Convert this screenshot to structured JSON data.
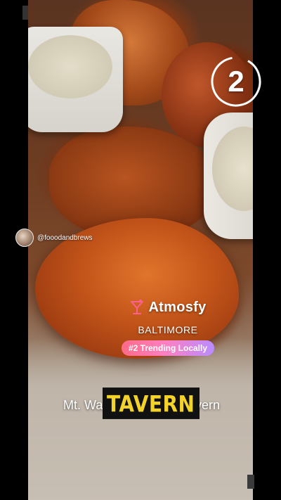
{
  "overlay": {
    "rank_number": "2",
    "creator_handle": "@fooodandbrews",
    "brand_name": "Atmosfy",
    "city": "BALTIMORE",
    "trend_badge": "#2 Trending Locally",
    "caption_left": "Mt. Wa",
    "caption_right": "avern",
    "highlight_word": "TAVERN"
  },
  "colors": {
    "brand_icon": "#ff5f8f",
    "badge_gradient_start": "#ff6a88",
    "badge_gradient_end": "#b98cff",
    "highlight_text": "#f3d22a",
    "highlight_bg": "#111111"
  },
  "icons": [
    "cocktail-glass-icon"
  ]
}
